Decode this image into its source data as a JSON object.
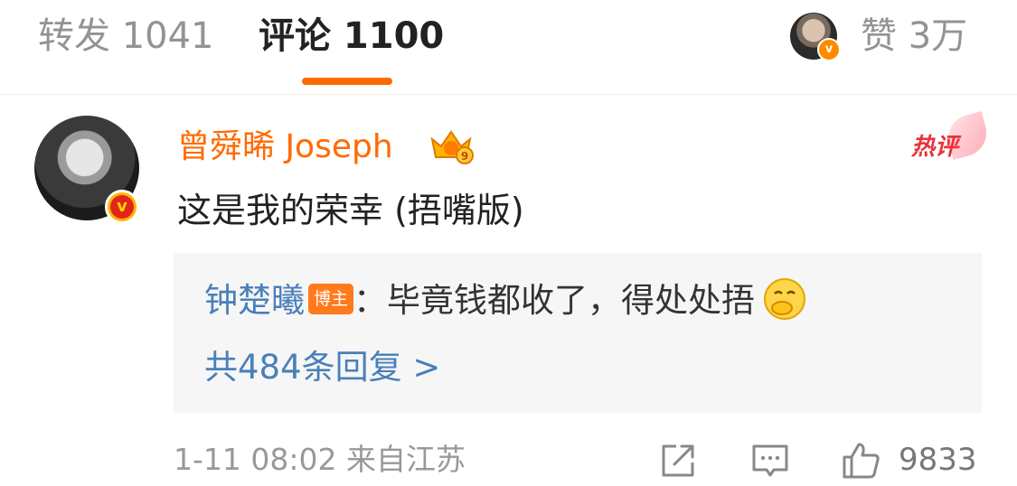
{
  "tabs": {
    "repost": "转发 1041",
    "comment": "评论 1100",
    "likes": "赞 3万"
  },
  "comment": {
    "username": "曾舜晞 Joseph",
    "hot_label": "热评",
    "text": "这是我的荣幸 (捂嘴版)",
    "reply": {
      "author": "钟楚曦",
      "badge": "博主",
      "text": "：毕竟钱都收了，得处处捂"
    },
    "reply_count": "共484条回复 >",
    "meta": "1-11 08:02  来自江苏",
    "like_count": "9833"
  },
  "colors": {
    "accent": "#ff6a00",
    "link": "#4a7fba",
    "hot": "#e8323c"
  }
}
